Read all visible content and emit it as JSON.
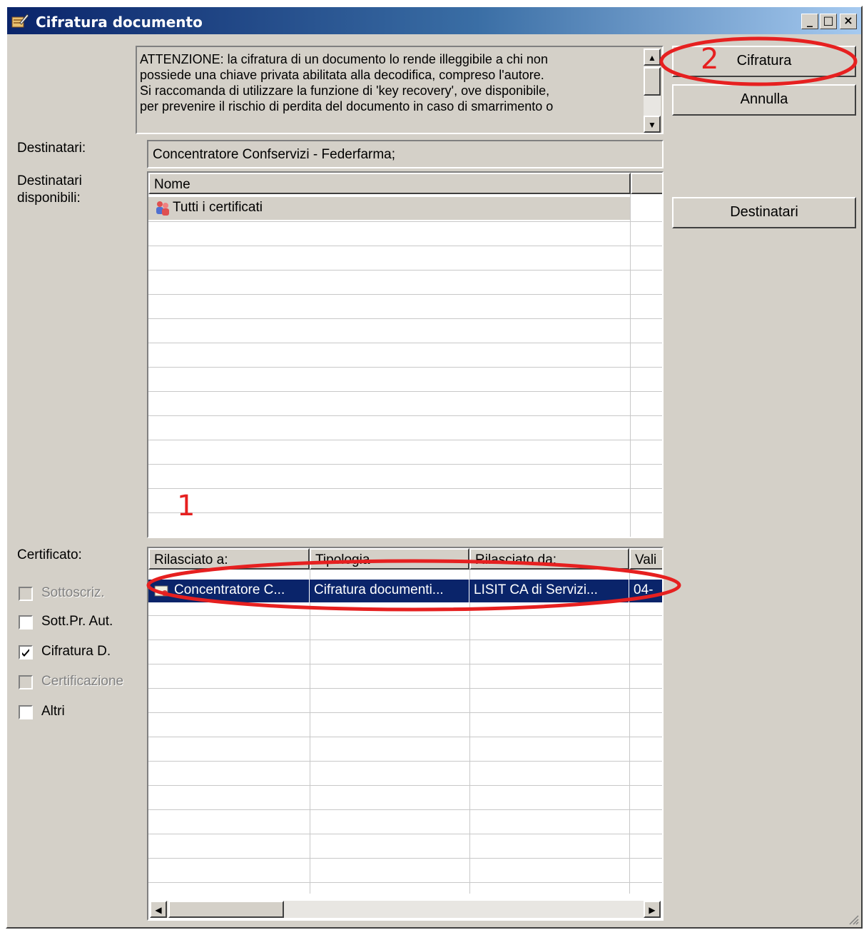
{
  "window": {
    "title": "Cifratura documento",
    "controls": {
      "minimize": "_",
      "maximize": "□",
      "close": "×"
    }
  },
  "warning_text": "ATTENZIONE: la cifratura di un documento lo rende illeggibile a chi non\npossiede una chiave privata abilitata alla decodifica, compreso l'autore.\nSi raccomanda di utilizzare la funzione di 'key recovery', ove disponibile,\nper prevenire il rischio di perdita del documento in caso di smarrimento o",
  "buttons": {
    "encrypt": "Cifratura",
    "cancel": "Annulla",
    "recipients": "Destinatari"
  },
  "labels": {
    "recipients": "Destinatari:",
    "available_recipients_1": "Destinatari",
    "available_recipients_2": "disponibili:",
    "certificate": "Certificato:"
  },
  "recipients_value": "Concentratore Confservizi - Federfarma;",
  "available_list": {
    "header": "Nome",
    "items": [
      {
        "label": "Tutti i certificati",
        "icon": "users-group-icon"
      }
    ]
  },
  "cert_list": {
    "columns": [
      "Rilasciato a:",
      "Tipologia",
      "Rilasciato da:",
      "Vali"
    ],
    "rows": [
      {
        "issued_to": "Concentratore C...",
        "type": "Cifratura documenti...",
        "issued_by": "LISIT CA di Servizi...",
        "valid": "04-",
        "icon": "certificate-icon",
        "selected": true
      }
    ]
  },
  "checkboxes": [
    {
      "label": "Sottoscriz.",
      "checked": false,
      "enabled": false
    },
    {
      "label": "Sott.Pr. Aut.",
      "checked": false,
      "enabled": true
    },
    {
      "label": "Cifratura D.",
      "checked": true,
      "enabled": true
    },
    {
      "label": "Certificazione",
      "checked": false,
      "enabled": false
    },
    {
      "label": "Altri",
      "checked": false,
      "enabled": true
    }
  ],
  "annotations": {
    "step1": "1",
    "step2": "2"
  },
  "colors": {
    "selection": "#0a246a",
    "annotation": "#e62020",
    "face": "#d4d0c8"
  }
}
